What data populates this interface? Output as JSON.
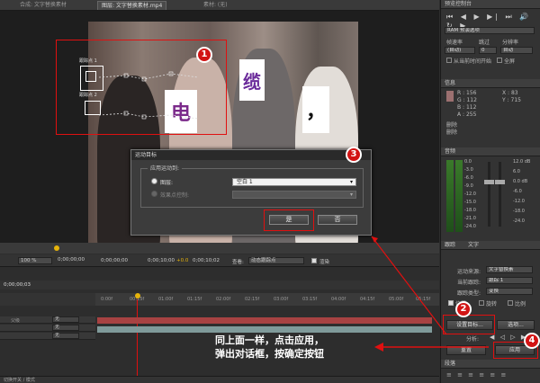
{
  "tabs": {
    "comp": "合成: 文字替换素材",
    "layer": "图层: 文字替换素材.mp4",
    "footage": "素材: (无)"
  },
  "viewer": {
    "cards": [
      "电",
      "缆",
      "，"
    ],
    "track_point_1": "跟踪点 1",
    "track_point_2": "跟踪点 2"
  },
  "badges": [
    "1",
    "2",
    "3",
    "4"
  ],
  "dialog": {
    "title": "运动目标",
    "group_label": "应用运动到:",
    "option_layer": "图层:",
    "option_layer_value": "空白 1",
    "option_effect": "效果点控制:",
    "yes": "是",
    "no": "否"
  },
  "preview": {
    "header": "预览控制台",
    "ram_option": "RAM 预演选项",
    "frame_rate_label": "帧速率",
    "skip_label": "跳过",
    "resolution_label": "分辨率",
    "frame_rate_value": "(自动)",
    "skip_value": "0",
    "resolution_value": "自动",
    "from_current": "从当前时间开始",
    "fullscreen": "全屏"
  },
  "info": {
    "header": "信息",
    "r": "R : 156",
    "g": "G : 112",
    "b": "B : 112",
    "a": "A : 255",
    "x": "X : 83",
    "y": "Y : 715",
    "status1": "删除",
    "status2": "删除"
  },
  "audio": {
    "header": "音频",
    "left_scale": [
      "0.0",
      "-3.0",
      "-6.0",
      "-9.0",
      "-12.0",
      "-15.0",
      "-18.0",
      "-21.0",
      "-24.0"
    ],
    "right_scale": [
      "12.0 dB",
      "6.0",
      "0.0 dB",
      "-6.0",
      "-12.0",
      "-18.0",
      "-24.0"
    ]
  },
  "tracker": {
    "tab1": "跟踪",
    "tab2": "文字",
    "motion_source_label": "运动来源:",
    "motion_source_value": "文字替换素",
    "current_track_label": "当前跟踪:",
    "current_track_value": "跟踪 1",
    "track_type_label": "跟踪类型:",
    "track_type_value": "变换",
    "position": "位置",
    "rotation": "旋转",
    "scale": "比例",
    "set_target": "设置目标...",
    "options": "选项...",
    "analyze_label": "分析:",
    "reset": "重置",
    "apply": "应用"
  },
  "paragraph": {
    "header": "段落"
  },
  "transport": {
    "zoom": "100 %",
    "time_a": "0;00;00;00",
    "time_b": "0;00;00;00",
    "time_c": "0;00;10;00",
    "time_d": "0;00;10;02",
    "view_label": "查看:",
    "view_value": "动态跟踪点",
    "render_label": "渲染",
    "delta": "+0.0",
    "timecode": "0;00;00;03"
  },
  "timeline": {
    "ruler": [
      "0:00f",
      "00:15f",
      "01:00f",
      "01:15f",
      "02:00f",
      "02:15f",
      "03:00f",
      "03:15f",
      "04:00f",
      "04:15f",
      "05:00f",
      "05:15f"
    ],
    "rows": [
      {
        "mode": "无",
        "label": "父级"
      },
      {
        "mode": "无",
        "label": ""
      },
      {
        "mode": "无",
        "label": ""
      }
    ],
    "bottom": "切换开关 / 模式"
  },
  "annotation": {
    "line1": "同上面一样，点击应用，",
    "line2": "弹出对话框，按确定按钮"
  }
}
